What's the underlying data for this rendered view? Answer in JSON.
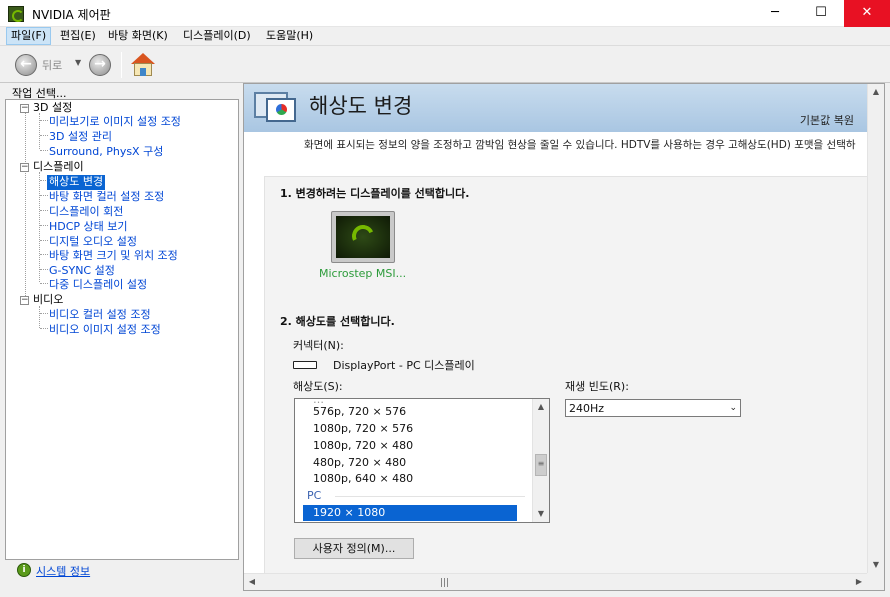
{
  "window": {
    "title": "NVIDIA 제어판",
    "minimize": "─",
    "maximize": "☐",
    "close": "✕"
  },
  "menu": [
    "파일(F)",
    "편집(E)",
    "바탕 화면(K)",
    "디스플레이(D)",
    "도움말(H)"
  ],
  "toolbar": {
    "back_label": "뒤로",
    "back_icon": "arrow-left-icon",
    "forward_icon": "arrow-right-icon",
    "home_icon": "home-icon"
  },
  "sidebar": {
    "task_label": "작업 선택...",
    "categories": [
      {
        "label": "3D 설정",
        "expander": "−",
        "items": [
          "미리보기로 이미지 설정 조정",
          "3D 설정 관리",
          "Surround, PhysX 구성"
        ]
      },
      {
        "label": "디스플레이",
        "expander": "−",
        "items": [
          "해상도 변경",
          "바탕 화면 컬러 설정 조정",
          "디스플레이 회전",
          "HDCP 상태 보기",
          "디지털 오디오 설정",
          "바탕 화면 크기 및 위치 조정",
          "G-SYNC 설정",
          "다중 디스플레이 설정"
        ]
      },
      {
        "label": "비디오",
        "expander": "−",
        "items": [
          "비디오 컬러 설정 조정",
          "비디오 이미지 설정 조정"
        ]
      }
    ],
    "selected_item": "해상도 변경",
    "system_info": "시스템 정보"
  },
  "main": {
    "title": "해상도 변경",
    "restore_defaults": "기본값 복원",
    "description": "화면에 표시되는 정보의 양을 조정하고 깜박임 현상을 줄일 수 있습니다. HDTV를 사용하는 경우 고해상도(HD) 포맷을 선택하",
    "step1": "1. 변경하려는 디스플레이를 선택합니다.",
    "display_name": "Microstep MSI...",
    "step2": "2. 해상도를 선택합니다.",
    "connector_label": "커넥터(N):",
    "connector_value": "DisplayPort - PC 디스플레이",
    "resolution_label": "해상도(S):",
    "resolutions": [
      "576p, 720 × 576",
      "1080p, 720 × 576",
      "1080p, 720 × 480",
      "480p, 720 × 480",
      "1080p, 640 × 480"
    ],
    "resolution_group": "PC",
    "resolution_selected": "1920 × 1080",
    "refresh_label": "재생 빈도(R):",
    "refresh_value": "240Hz",
    "custom_button": "사용자 정의(M)..."
  }
}
